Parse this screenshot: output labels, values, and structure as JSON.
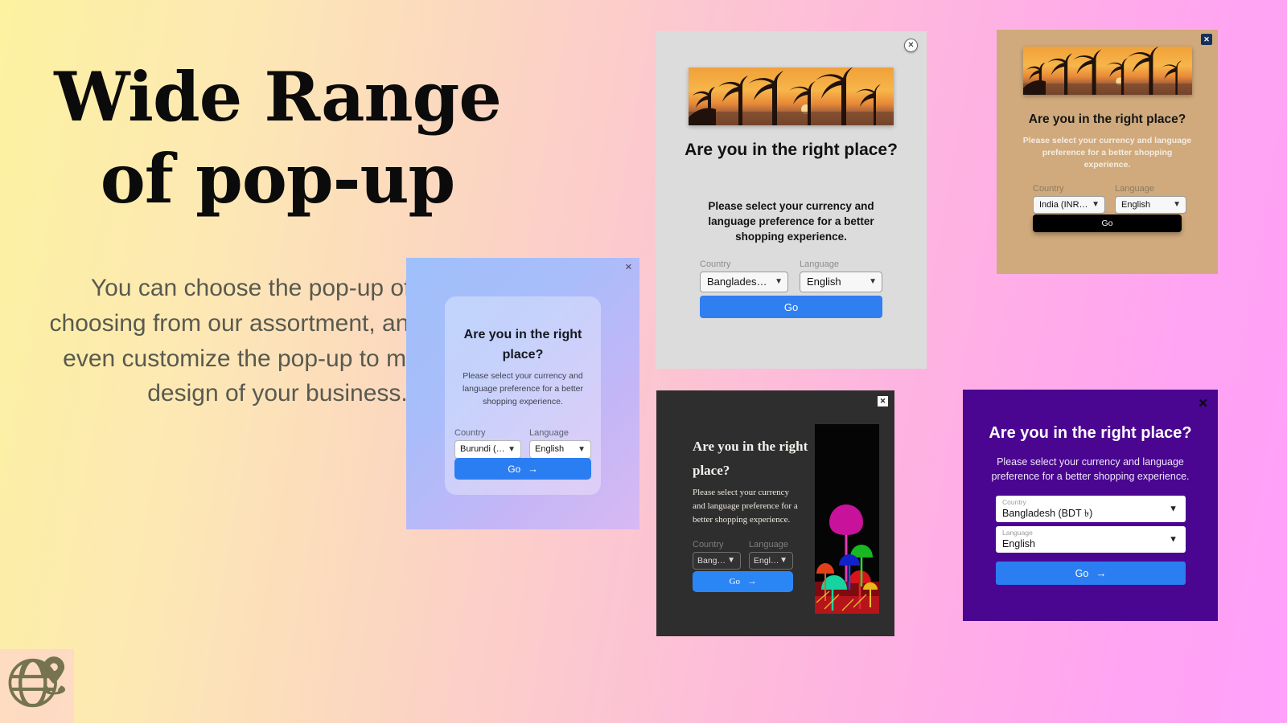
{
  "slide": {
    "headline": "Wide Range of pop-up",
    "body": "You can choose the pop-up of your choosing from our assortment, and we can even customize the pop-up to match the design of your business.",
    "logo_icon": "globe-location-pin-icon",
    "background_colors": {
      "start": "#fcf2a0",
      "end": "#ffa0fb"
    }
  },
  "shared": {
    "title": "Are you in the right place?",
    "subtitle": "Please select your currency and language preference for a better shopping experience.",
    "country_label": "Country",
    "language_label": "Language",
    "close_icon": "close-icon"
  },
  "popups": [
    {
      "id": "gray",
      "theme_color": "#dcdcdc",
      "title": "Are you in the right place?",
      "subtitle": "Please select your currency and language preference for a better shopping experience.",
      "country_label": "Country",
      "country_value": "Bangladesh (B...",
      "language_label": "Language",
      "language_value": "English",
      "button_label": "Go",
      "button_color": "#2f7ff0",
      "banner_image": "palm-trees-sunset-photo",
      "close_icon": "close-icon"
    },
    {
      "id": "tan",
      "theme_color": "#d0aa7c",
      "title": "Are you in the right place?",
      "subtitle": "Please select your currency and language preference for a better shopping experience.",
      "country_label": "Country",
      "country_value": "India (INR ₹)",
      "language_label": "Language",
      "language_value": "English",
      "button_label": "Go",
      "button_color": "#000000",
      "banner_image": "palm-trees-sunset-photo",
      "close_icon": "close-icon"
    },
    {
      "id": "blue",
      "theme_color": "#9fc0fb",
      "title": "Are you in the right place?",
      "subtitle": "Please select your currency and language preference for a better shopping experience.",
      "country_label": "Country",
      "country_value": "Burundi (BIF Fr)",
      "language_label": "Language",
      "language_value": "English",
      "button_label": "Go",
      "button_arrow": "→",
      "button_color": "#2b7df2",
      "close_icon": "close-icon"
    },
    {
      "id": "dark",
      "theme_color": "#2e2e2e",
      "title": "Are you in the right place?",
      "subtitle": "Please select your currency and language preference for a better shopping experience.",
      "country_label": "Country",
      "country_value": "Banglad...",
      "language_label": "Language",
      "language_value": "English",
      "button_label": "Go",
      "button_arrow": "→",
      "button_color": "#2b86f5",
      "side_image": "neon-mushrooms-photo",
      "close_icon": "close-icon"
    },
    {
      "id": "purple",
      "theme_color": "#4a0690",
      "title": "Are you in the right place?",
      "subtitle": "Please select your currency and language preference for a better shopping experience.",
      "country_label": "Country",
      "country_value": "Bangladesh (BDT ৳)",
      "language_label": "Language",
      "language_value": "English",
      "button_label": "Go",
      "button_arrow": "→",
      "button_color": "#2b7df2",
      "close_icon": "close-icon"
    }
  ]
}
